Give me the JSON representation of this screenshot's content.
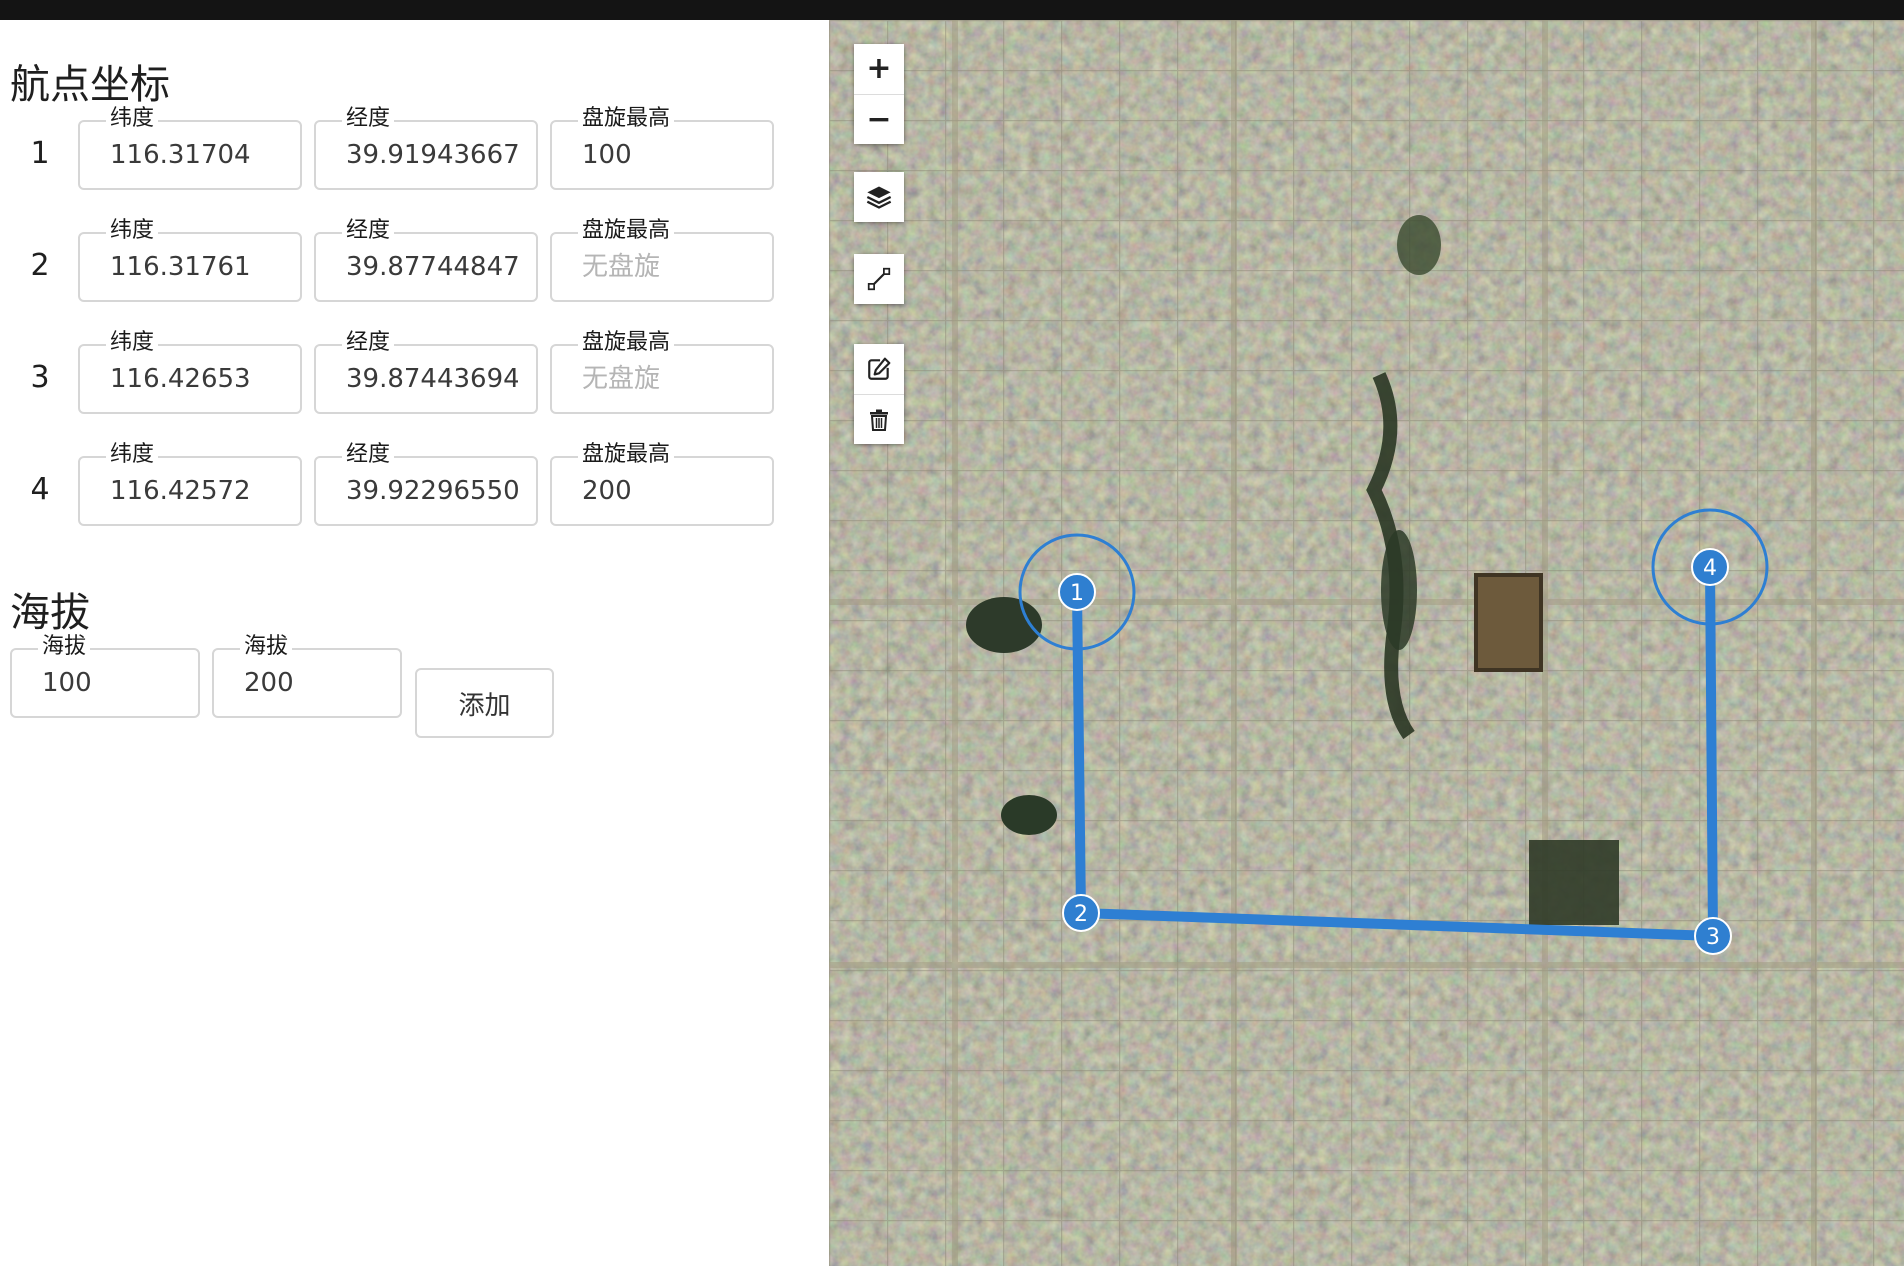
{
  "waypoints_section": {
    "title": "航点坐标",
    "rows": [
      {
        "index": "1",
        "lat_label": "纬度",
        "lat_value": "116.31704",
        "lng_label": "经度",
        "lng_value": "39.91943667",
        "orbit_label": "盘旋最高",
        "orbit_value": "100",
        "orbit_placeholder": ""
      },
      {
        "index": "2",
        "lat_label": "纬度",
        "lat_value": "116.31761",
        "lng_label": "经度",
        "lng_value": "39.87744847",
        "orbit_label": "盘旋最高",
        "orbit_value": "",
        "orbit_placeholder": "无盘旋"
      },
      {
        "index": "3",
        "lat_label": "纬度",
        "lat_value": "116.42653",
        "lng_label": "经度",
        "lng_value": "39.87443694",
        "orbit_label": "盘旋最高",
        "orbit_value": "",
        "orbit_placeholder": "无盘旋"
      },
      {
        "index": "4",
        "lat_label": "纬度",
        "lat_value": "116.42572",
        "lng_label": "经度",
        "lng_value": "39.92296550",
        "orbit_label": "盘旋最高",
        "orbit_value": "200",
        "orbit_placeholder": ""
      }
    ]
  },
  "altitude_section": {
    "title": "海拔",
    "fields": [
      {
        "label": "海拔",
        "value": "100"
      },
      {
        "label": "海拔",
        "value": "200"
      }
    ],
    "add_label": "添加"
  },
  "map": {
    "zoom_in_symbol": "+",
    "zoom_out_symbol": "−",
    "markers": [
      {
        "label": "1"
      },
      {
        "label": "2"
      },
      {
        "label": "3"
      },
      {
        "label": "4"
      }
    ],
    "icons": [
      "plus-icon",
      "minus-icon",
      "layers-icon",
      "draw-line-icon",
      "edit-icon",
      "trash-icon"
    ],
    "route_color": "#2e7fd3",
    "marker_color": "#2f7fd0"
  }
}
